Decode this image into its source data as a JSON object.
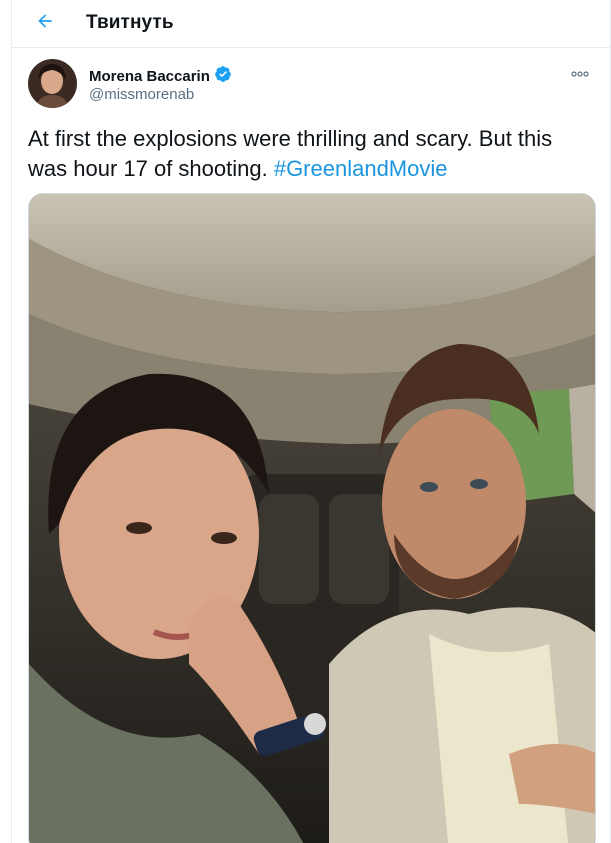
{
  "topbar": {
    "title": "Твитнуть",
    "back_icon": "arrow-left-icon"
  },
  "tweet": {
    "author": {
      "display_name": "Morena Baccarin",
      "handle": "@missmorenab",
      "verified": true
    },
    "text_prefix": "At first the explosions were thrilling and scary. But this was hour 17 of shooting. ",
    "hashtag": "#GreenlandMovie",
    "more_icon": "more-horizontal-icon"
  },
  "colors": {
    "accent": "#1b95e0",
    "verified": "#1da1f2",
    "secondary_text": "#5b7083",
    "border": "#e6ecf0"
  }
}
